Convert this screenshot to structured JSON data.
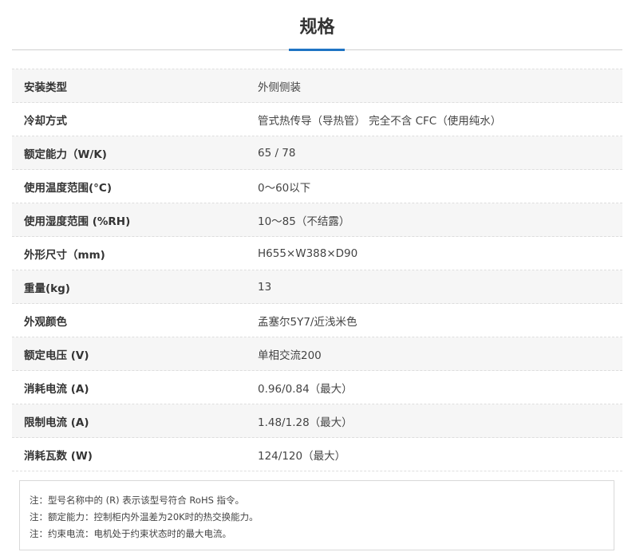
{
  "section": {
    "title": "规格",
    "accent_color": "#1f74c4"
  },
  "specs": [
    {
      "label": "安装类型",
      "value": "外侧侧装"
    },
    {
      "label": "冷却方式",
      "value": "管式热传导（导热管） 完全不含 CFC（使用纯水）"
    },
    {
      "label": "额定能力（W/K)",
      "value": "65 / 78"
    },
    {
      "label": "使用温度范围(°C)",
      "value": "0～60以下"
    },
    {
      "label": "使用湿度范围 (%RH)",
      "value": "10～85（不结露）"
    },
    {
      "label": "外形尺寸（mm)",
      "value": "H655×W388×D90"
    },
    {
      "label": "重量(kg)",
      "value": "13"
    },
    {
      "label": "外观颜色",
      "value": "孟塞尔5Y7/近浅米色"
    },
    {
      "label": "额定电压 (V)",
      "value": "单相交流200"
    },
    {
      "label": "消耗电流 (A)",
      "value": "0.96/0.84（最大）"
    },
    {
      "label": "限制电流 (A)",
      "value": "1.48/1.28（最大）"
    },
    {
      "label": "消耗瓦数 (W)",
      "value": "124/120（最大）"
    }
  ],
  "notes": [
    "注：型号名称中的 (R) 表示该型号符合 RoHS 指令。",
    "注：额定能力：控制柜内外温差为20K时的热交换能力。",
    "注：约束电流：电机处于约束状态时的最大电流。"
  ]
}
